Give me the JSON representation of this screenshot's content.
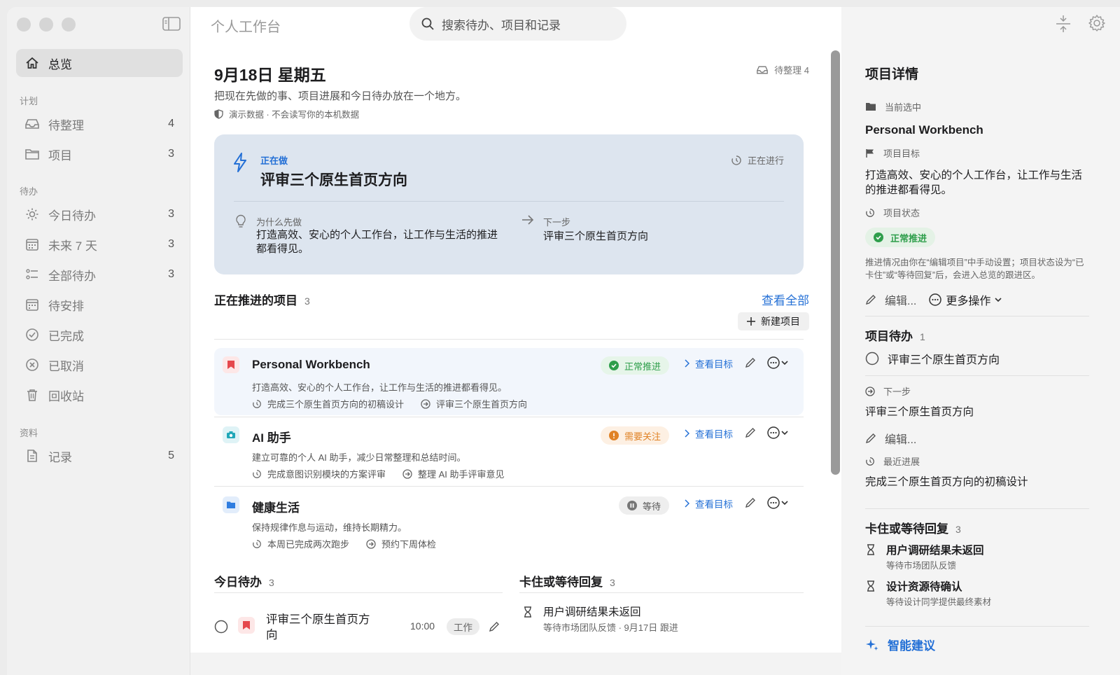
{
  "sidebar": {
    "overview": "总览",
    "sections": {
      "plan": "计划",
      "todo": "待办",
      "data": "资料"
    },
    "plan_items": [
      {
        "label": "待整理",
        "count": "4",
        "icon": "inbox-icon"
      },
      {
        "label": "项目",
        "count": "3",
        "icon": "folder-icon"
      }
    ],
    "todo_items": [
      {
        "label": "今日待办",
        "count": "3",
        "icon": "sun-icon"
      },
      {
        "label": "未来 7 天",
        "count": "3",
        "icon": "calendar-icon"
      },
      {
        "label": "全部待办",
        "count": "3",
        "icon": "list-icon"
      },
      {
        "label": "待安排",
        "count": "",
        "icon": "calendar-icon"
      },
      {
        "label": "已完成",
        "count": "",
        "icon": "check-circle-icon"
      },
      {
        "label": "已取消",
        "count": "",
        "icon": "x-circle-icon"
      },
      {
        "label": "回收站",
        "count": "",
        "icon": "trash-icon"
      }
    ],
    "data_items": [
      {
        "label": "记录",
        "count": "5",
        "icon": "document-icon"
      }
    ]
  },
  "header": {
    "app_title": "个人工作台",
    "search_placeholder": "搜索待办、项目和记录"
  },
  "main": {
    "date": "9月18日 星期五",
    "subtitle": "把现在先做的事、项目进展和今日待办放在一个地方。",
    "demo_note": "演示数据 · 不会读写你的本机数据",
    "inbox_badge": "待整理 4",
    "focus": {
      "now_label": "正在做",
      "task": "评审三个原生首页方向",
      "status": "正在进行",
      "why_label": "为什么先做",
      "why_text": "打造高效、安心的个人工作台，让工作与生活的推进都看得见。",
      "next_label": "下一步",
      "next_text": "评审三个原生首页方向"
    },
    "projects_section": {
      "title": "正在推进的项目",
      "count": "3",
      "see_all": "查看全部",
      "new_project": "新建项目"
    },
    "projects": [
      {
        "name": "Personal Workbench",
        "desc": "打造高效、安心的个人工作台，让工作与生活的推进都看得见。",
        "recent": "完成三个原生首页方向的初稿设计",
        "next": "评审三个原生首页方向",
        "status": "正常推进",
        "view_goal": "查看目标",
        "icon_color": "#e5484d"
      },
      {
        "name": "AI 助手",
        "desc": "建立可靠的个人 AI 助手，减少日常整理和总结时间。",
        "recent": "完成意图识别模块的方案评审",
        "next": "整理 AI 助手评审意见",
        "status": "需要关注",
        "view_goal": "查看目标",
        "icon_color": "#1fa7b8"
      },
      {
        "name": "健康生活",
        "desc": "保持规律作息与运动，维持长期精力。",
        "recent": "本周已完成两次跑步",
        "next": "预约下周体检",
        "status": "等待",
        "view_goal": "查看目标",
        "icon_color": "#2f7de0"
      }
    ],
    "today": {
      "title": "今日待办",
      "count": "3",
      "item": {
        "title": "评审三个原生首页方向",
        "time": "10:00",
        "tag": "工作"
      }
    },
    "blocked": {
      "title": "卡住或等待回复",
      "count": "3",
      "item": {
        "title": "用户调研结果未返回",
        "sub": "等待市场团队反馈 · 9月17日 跟进"
      }
    }
  },
  "inspector": {
    "title": "项目详情",
    "current_label": "当前选中",
    "project_name": "Personal Workbench",
    "goal_label": "项目目标",
    "goal_text": "打造高效、安心的个人工作台，让工作与生活的推进都看得见。",
    "status_label": "项目状态",
    "status": "正常推进",
    "status_note": "推进情况由你在“编辑项目”中手动设置；项目状态设为“已卡住”或“等待回复”后，会进入总览的跟进区。",
    "edit": "编辑...",
    "more_actions": "更多操作",
    "todos_title": "项目待办",
    "todos_count": "1",
    "todo_item": "评审三个原生首页方向",
    "next_label": "下一步",
    "next_text": "评审三个原生首页方向",
    "next_edit": "编辑...",
    "recent_label": "最近进展",
    "recent_text": "完成三个原生首页方向的初稿设计",
    "blocked_title": "卡住或等待回复",
    "blocked_count": "3",
    "blocked_items": [
      {
        "title": "用户调研结果未返回",
        "sub": "等待市场团队反馈"
      },
      {
        "title": "设计资源待确认",
        "sub": "等待设计同学提供最终素材"
      }
    ],
    "smart_suggest": "智能建议"
  },
  "colors": {
    "accent": "#2470d6",
    "green": "#2e9e4b",
    "orange": "#e08226",
    "focus_card": "#dde5ef"
  }
}
